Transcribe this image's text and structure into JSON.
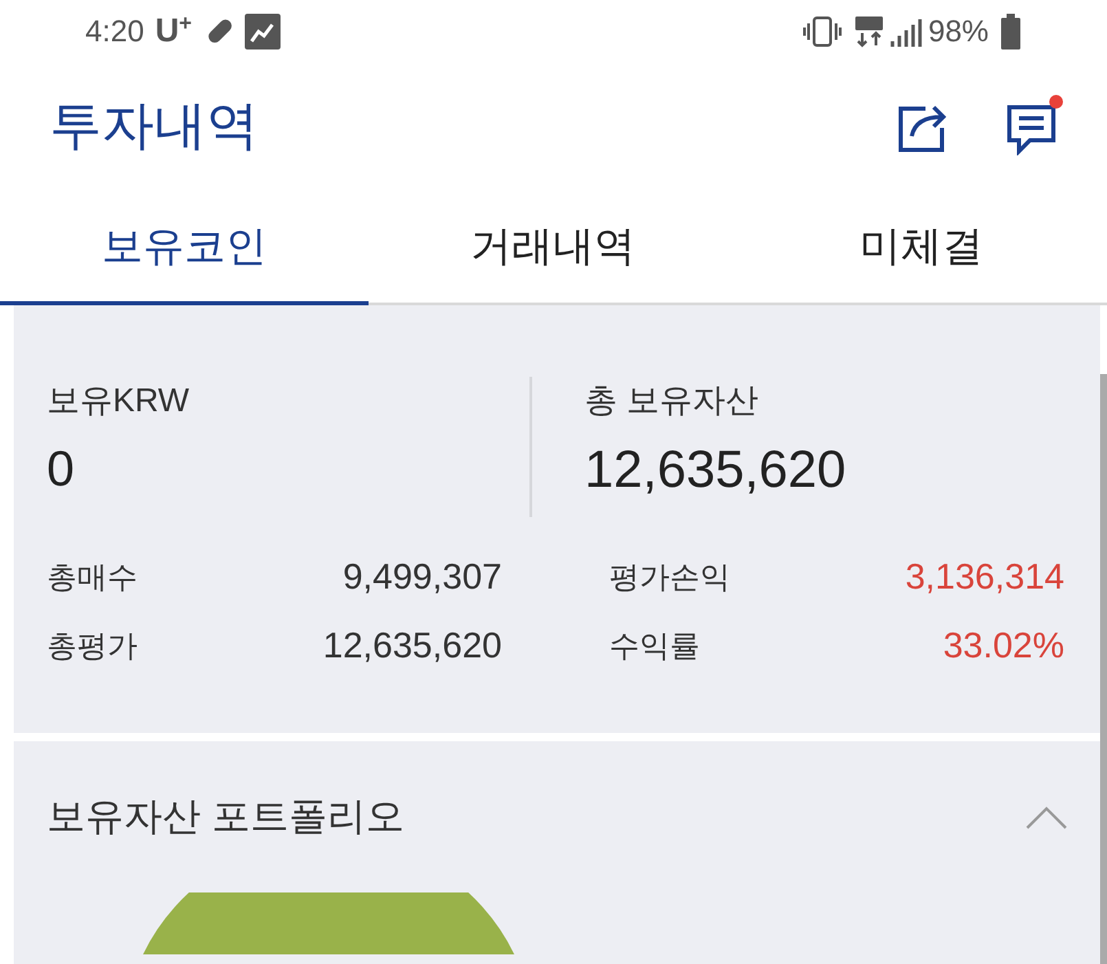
{
  "status_bar": {
    "time": "4:20",
    "carrier": "U",
    "carrier_mark": "+",
    "battery": "98%"
  },
  "header": {
    "title": "투자내역",
    "notification_badge": true
  },
  "tabs": [
    {
      "label": "보유코인",
      "selected": true
    },
    {
      "label": "거래내역",
      "selected": false
    },
    {
      "label": "미체결",
      "selected": false
    }
  ],
  "summary": {
    "krw_label": "보유KRW",
    "krw_value": "0",
    "total_label": "총 보유자산",
    "total_value": "12,635,620",
    "rows": [
      {
        "label": "총매수",
        "value": "9,499,307",
        "positive": false
      },
      {
        "label": "총평가",
        "value": "12,635,620",
        "positive": false
      },
      {
        "label": "평가손익",
        "value": "3,136,314",
        "positive": true
      },
      {
        "label": "수익률",
        "value": "33.02%",
        "positive": true
      }
    ]
  },
  "portfolio": {
    "title": "보유자산 포트폴리오",
    "expanded": true
  }
}
